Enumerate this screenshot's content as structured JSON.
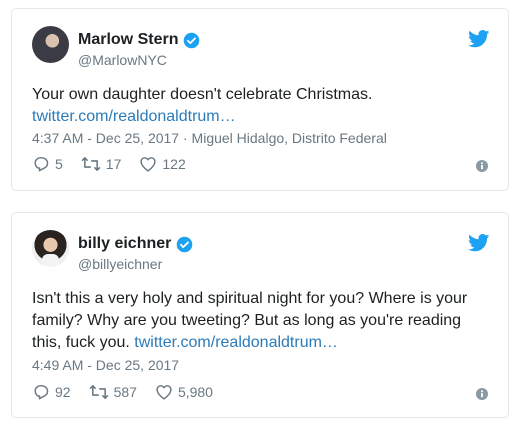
{
  "tweets": [
    {
      "name": "Marlow Stern",
      "handle": "@MarlowNYC",
      "text": "Your own daughter doesn't celebrate Christmas.",
      "link": "twitter.com/realdonaldtrum…",
      "timestamp": "4:37 AM - Dec 25, 2017",
      "location": "Miguel Hidalgo, Distrito Federal",
      "replies": "5",
      "retweets": "17",
      "likes": "122"
    },
    {
      "name": "billy eichner",
      "handle": "@billyeichner",
      "text": "Isn't this a very holy and spiritual night for you? Where is your family? Why are you tweeting? But as long as you're reading this, fuck you.",
      "link": "twitter.com/realdonaldtrum…",
      "timestamp": "4:49 AM - Dec 25, 2017",
      "replies": "92",
      "retweets": "587",
      "likes": "5,980"
    }
  ],
  "colors": {
    "verified": "#1da1f2",
    "twitter_bird": "#1da1f2",
    "link": "#2b7bb9",
    "meta": "#697882"
  },
  "icons": [
    "verified-badge-icon",
    "twitter-bird-icon",
    "reply-icon",
    "retweet-icon",
    "like-icon",
    "info-icon"
  ]
}
